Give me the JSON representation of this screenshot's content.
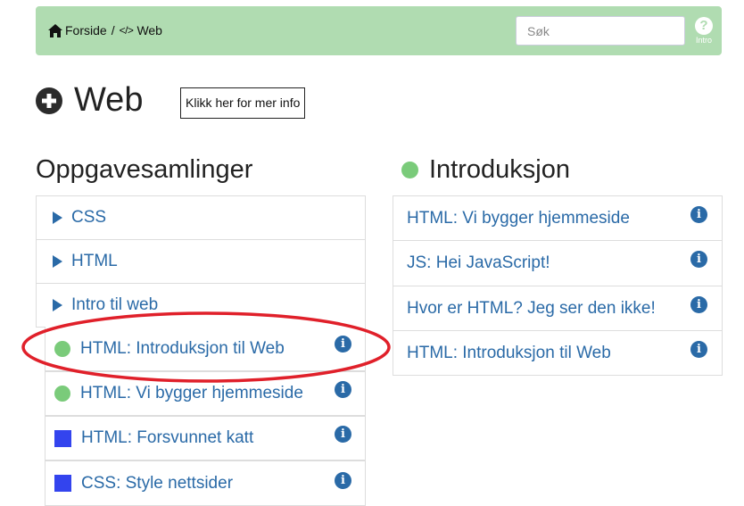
{
  "breadcrumb": {
    "home_label": "Forside",
    "separator": "/",
    "code_glyph": "</>",
    "current": "Web"
  },
  "search": {
    "placeholder": "Søk"
  },
  "help": {
    "symbol": "?",
    "label": "Intro"
  },
  "page": {
    "title": "Web",
    "info_button": "Klikk her for mer info"
  },
  "collections": {
    "title": "Oppgavesamlinger",
    "folders": [
      {
        "label": "CSS"
      },
      {
        "label": "HTML"
      },
      {
        "label": "Intro til web"
      }
    ],
    "lessons": [
      {
        "label": "HTML: Introduksjon til Web",
        "marker": "green-circle"
      },
      {
        "label": "HTML: Vi bygger hjemmeside",
        "marker": "green-circle"
      },
      {
        "label": "HTML: Forsvunnet katt",
        "marker": "blue-square"
      },
      {
        "label": "CSS: Style nettsider",
        "marker": "blue-square"
      }
    ]
  },
  "introduction": {
    "title": "Introduksjon",
    "items": [
      {
        "label": "HTML: Vi bygger hjemmeside"
      },
      {
        "label": "JS: Hei JavaScript!"
      },
      {
        "label": "Hvor er HTML? Jeg ser den ikke!"
      },
      {
        "label": "HTML: Introduksjon til Web"
      }
    ]
  },
  "icons": {
    "info": "i"
  },
  "colors": {
    "topbar": "#b0dcb1",
    "link": "#2a6aa7",
    "green_marker": "#7acb7a",
    "blue_marker": "#3344ee",
    "highlight": "#e0202a"
  }
}
